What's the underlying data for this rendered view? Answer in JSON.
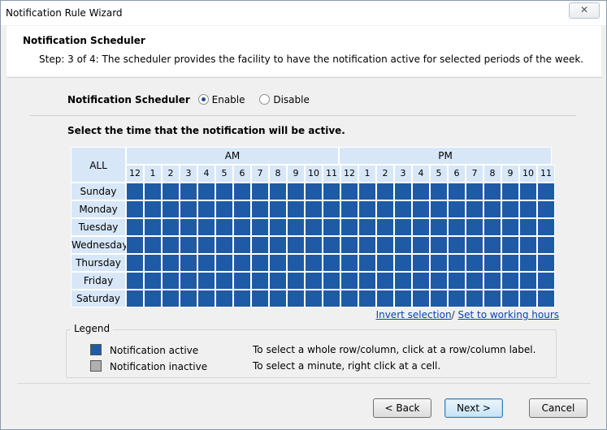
{
  "window": {
    "title": "Notification Rule Wizard",
    "close_glyph": "✕"
  },
  "header": {
    "title": "Notification Scheduler",
    "step": "Step: 3 of 4: The scheduler provides the facility to have the notification active for selected periods of the week."
  },
  "scheduler": {
    "label": "Notification Scheduler",
    "enable_label": "Enable",
    "disable_label": "Disable",
    "selected": "Enable"
  },
  "grid": {
    "title": "Select the time that the notification will be active.",
    "all_label": "ALL",
    "am_label": "AM",
    "pm_label": "PM",
    "hours": [
      "12",
      "1",
      "2",
      "3",
      "4",
      "5",
      "6",
      "7",
      "8",
      "9",
      "10",
      "11",
      "12",
      "1",
      "2",
      "3",
      "4",
      "5",
      "6",
      "7",
      "8",
      "9",
      "10",
      "11"
    ],
    "days": [
      "Sunday",
      "Monday",
      "Tuesday",
      "Wednesday",
      "Thursday",
      "Friday",
      "Saturday"
    ],
    "all_active": true
  },
  "links": {
    "invert": "Invert selection",
    "separator": "/",
    "working_hours": "Set to working hours"
  },
  "legend": {
    "title": "Legend",
    "active_label": "Notification active",
    "inactive_label": "Notification inactive",
    "active_hint": "To select a whole row/column, click at a row/column label.",
    "inactive_hint": "To select a minute, right click at a cell."
  },
  "colors": {
    "active": "#1f5aa6",
    "inactive": "#b0b0b0",
    "header_cell": "#d7e7f7"
  },
  "buttons": {
    "back": "< Back",
    "next": "Next >",
    "cancel": "Cancel"
  }
}
